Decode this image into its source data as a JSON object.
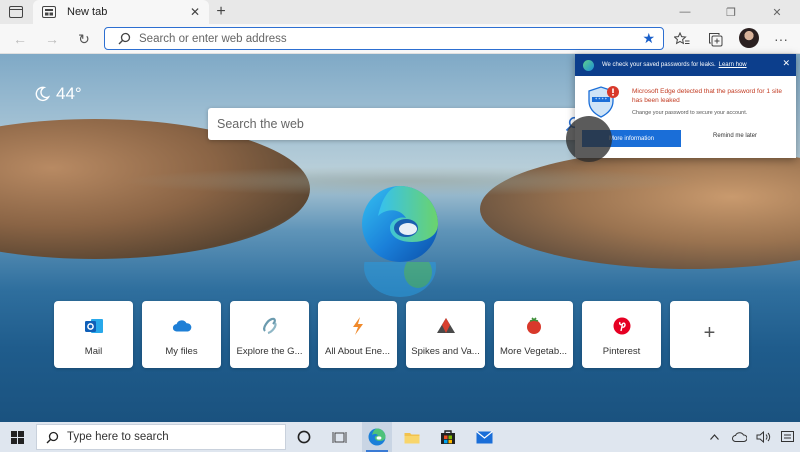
{
  "tab": {
    "title": "New tab",
    "close": "✕",
    "new": "+"
  },
  "window": {
    "minimize": "—",
    "maximize": "❐",
    "close": "✕"
  },
  "toolbar": {
    "back": "←",
    "forward": "→",
    "refresh": "↻",
    "more": "···",
    "address_placeholder": "Search or enter web address",
    "favorite_star": "★"
  },
  "page": {
    "weather_temp": "44°",
    "search_placeholder": "Search the web",
    "quick_links": [
      {
        "label": "Mail",
        "icon": "outlook-icon"
      },
      {
        "label": "My files",
        "icon": "onedrive-icon"
      },
      {
        "label": "Explore the G...",
        "icon": "link-icon"
      },
      {
        "label": "All About Ene...",
        "icon": "lightning-icon"
      },
      {
        "label": "Spikes and Va...",
        "icon": "mountain-icon"
      },
      {
        "label": "More Vegetab...",
        "icon": "tomato-icon"
      },
      {
        "label": "Pinterest",
        "icon": "pinterest-icon"
      }
    ],
    "add_tile": "+"
  },
  "popup": {
    "header": "We check your saved passwords for leaks.",
    "learn_more": "Learn how",
    "close": "✕",
    "alert_title": "Microsoft Edge detected that the password for 1 site has been leaked",
    "alert_sub": "Change your password to secure your account.",
    "primary_button": "More information",
    "secondary_button": "Remind me later"
  },
  "taskbar": {
    "search_placeholder": "Type here to search"
  },
  "colors": {
    "accent": "#1a6ed8",
    "popup_header": "#0c3e8c",
    "alert_red": "#c23b22",
    "favorite_star": "#1a5fc9"
  }
}
